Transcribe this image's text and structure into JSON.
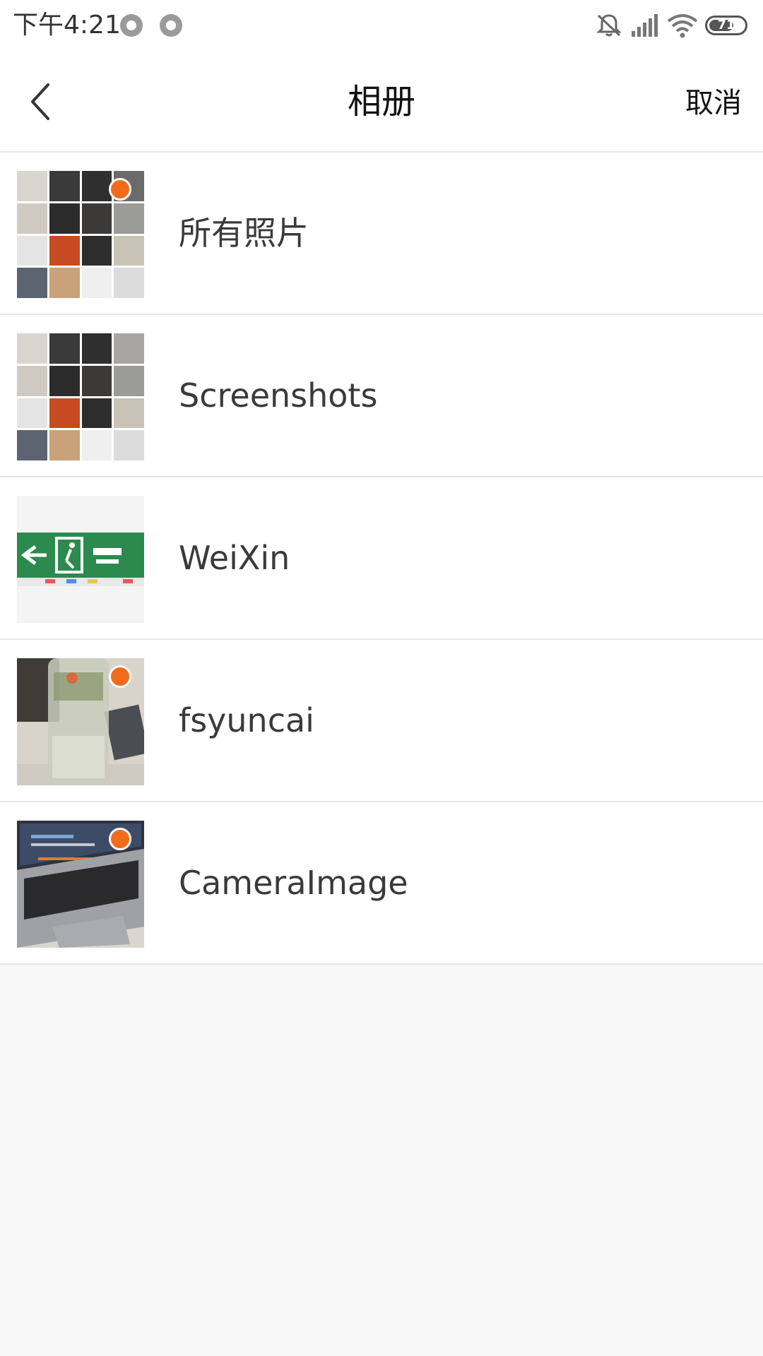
{
  "status_bar": {
    "time": "下午4:21",
    "battery_level": "71",
    "battery_fraction": 0.71,
    "icons": [
      "sync-dot-icon",
      "sync-dot-icon",
      "mute-bell-icon",
      "signal-icon",
      "wifi-icon",
      "battery-icon"
    ]
  },
  "header": {
    "title": "相册",
    "cancel_label": "取消",
    "back_icon": "chevron-left-icon"
  },
  "albums": [
    {
      "name": "所有照片",
      "has_new": true
    },
    {
      "name": "Screenshots",
      "has_new": false
    },
    {
      "name": "WeiXin",
      "has_new": false
    },
    {
      "name": "fsyuncai",
      "has_new": true
    },
    {
      "name": "CameraImage",
      "has_new": true
    }
  ],
  "colors": {
    "accent_dot": "#f26b1d",
    "background": "#f8f8f8",
    "divider": "#e6e6e6"
  }
}
